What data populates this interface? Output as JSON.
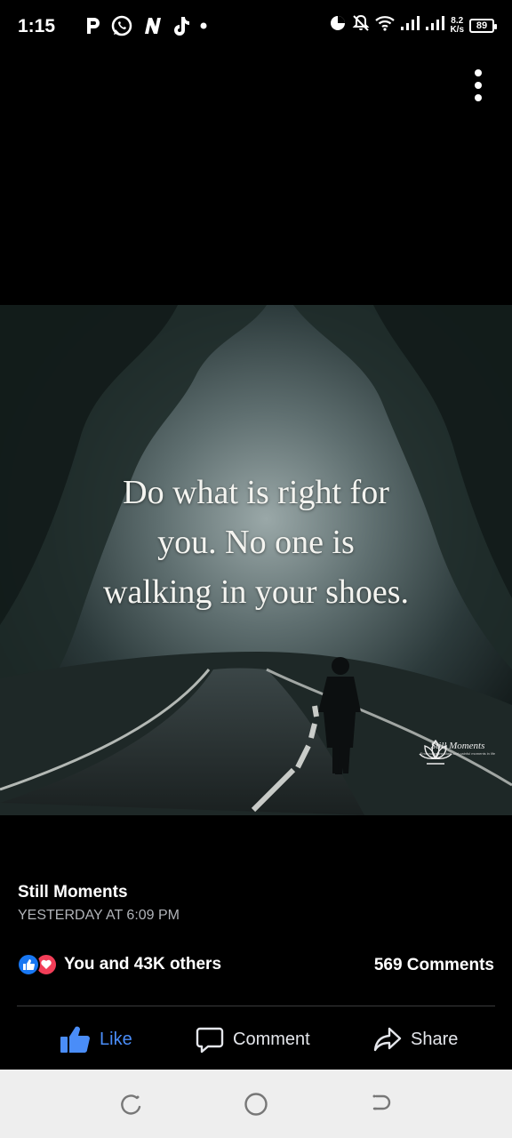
{
  "status_bar": {
    "time": "1:15",
    "net_speed_value": "8.2",
    "net_speed_unit": "K/s",
    "battery": "89",
    "icons": [
      "p-app-icon",
      "whatsapp-icon",
      "n-app-icon",
      "tiktok-icon",
      "dot-icon",
      "data-saver-icon",
      "mute-icon",
      "wifi-icon",
      "signal-icon",
      "signal-icon"
    ]
  },
  "post": {
    "image": {
      "quote_lines": [
        "Do what is right for",
        "you. No one is",
        "walking in your shoes."
      ],
      "brand_name": "Still Moments",
      "brand_tagline": "Embracing the stark and painful moments in life"
    },
    "page_name": "Still Moments",
    "timestamp": "YESTERDAY AT 6:09 PM",
    "reactions_text": "You and 43K others",
    "comments_text": "569 Comments"
  },
  "actions": {
    "like": "Like",
    "comment": "Comment",
    "share": "Share"
  },
  "colors": {
    "like_active": "#4a8df8",
    "like_reaction": "#1877f2",
    "love_reaction": "#f33e58",
    "secondary_text": "#b0b3b8"
  }
}
